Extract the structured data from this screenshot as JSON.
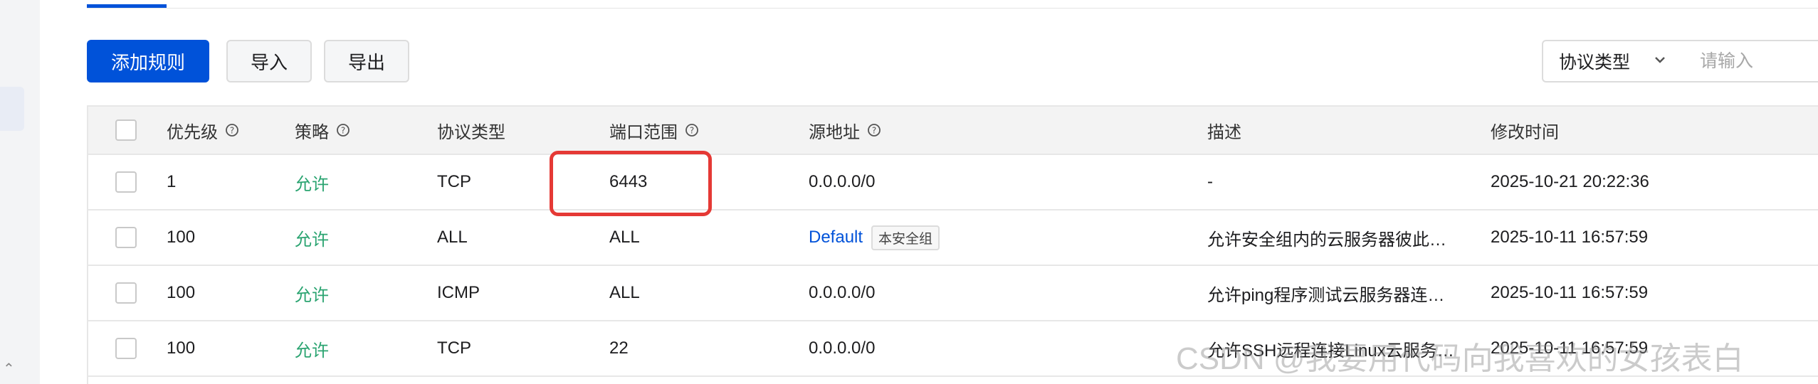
{
  "toolbar": {
    "add_rule_label": "添加规则",
    "import_label": "导入",
    "export_label": "导出"
  },
  "filter": {
    "protocol_select_label": "协议类型",
    "search_placeholder": "请输入"
  },
  "table": {
    "columns": {
      "priority": "优先级",
      "policy": "策略",
      "protocol": "协议类型",
      "port": "端口范围",
      "source": "源地址",
      "description": "描述",
      "modified": "修改时间"
    },
    "rows": [
      {
        "priority": "1",
        "policy": "允许",
        "protocol": "TCP",
        "port": "6443",
        "source": "0.0.0.0/0",
        "description": "-",
        "modified": "2025-10-21 20:22:36"
      },
      {
        "priority": "100",
        "policy": "允许",
        "protocol": "ALL",
        "port": "ALL",
        "source": "Default",
        "source_tag": "本安全组",
        "description": "允许安全组内的云服务器彼此…",
        "modified": "2025-10-11 16:57:59"
      },
      {
        "priority": "100",
        "policy": "允许",
        "protocol": "ICMP",
        "port": "ALL",
        "source": "0.0.0.0/0",
        "description": "允许ping程序测试云服务器连…",
        "modified": "2025-10-11 16:57:59"
      },
      {
        "priority": "100",
        "policy": "允许",
        "protocol": "TCP",
        "port": "22",
        "source": "0.0.0.0/0",
        "description": "允许SSH远程连接Linux云服务…",
        "modified": "2025-10-11 16:57:59"
      }
    ]
  },
  "watermark": "CSDN @我要用代码向我喜欢的女孩表白",
  "colors": {
    "primary": "#0052d9",
    "allow": "#2ba471",
    "highlight": "#e53935"
  }
}
